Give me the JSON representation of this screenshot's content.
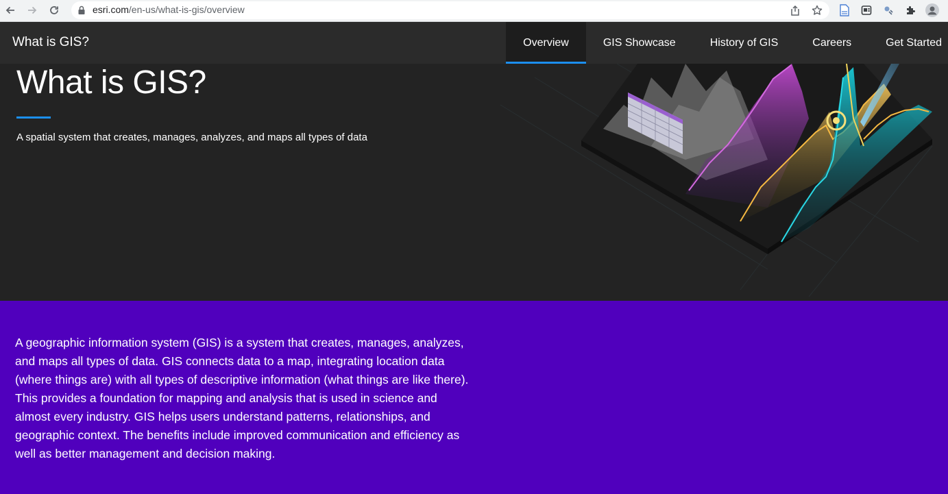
{
  "browser": {
    "url_domain": "esri.com",
    "url_path": "/en-us/what-is-gis/overview"
  },
  "site": {
    "title": "What is GIS?",
    "tabs": [
      {
        "label": "Overview",
        "active": true
      },
      {
        "label": "GIS Showcase",
        "active": false
      },
      {
        "label": "History of GIS",
        "active": false
      },
      {
        "label": "Careers",
        "active": false
      },
      {
        "label": "Get Started",
        "active": false
      }
    ]
  },
  "hero": {
    "title": "What is GIS?",
    "subtitle": "A spatial system that creates, manages, analyzes, and maps all types of data"
  },
  "intro": {
    "text": "A geographic information system (GIS) is a system that creates, manages, analyzes, and maps all types of data. GIS connects data to a map, integrating location data (where things are) with all types of descriptive information (what things are like there). This provides a foundation for mapping and analysis that is used in science and almost every industry. GIS helps users understand patterns, relationships, and geographic context. The benefits include improved communication and efficiency as well as better management and decision making."
  },
  "colors": {
    "accent": "#1c8ff0",
    "nav_bg": "#2b2b2b",
    "hero_bg": "#232323",
    "intro_bg": "#5000bd"
  },
  "icons": [
    "back-arrow-icon",
    "forward-arrow-icon",
    "reload-icon",
    "lock-icon",
    "share-icon",
    "bookmark-star-icon",
    "document-extension-icon",
    "extension-icon",
    "satellite-extension-icon",
    "puzzle-extensions-icon",
    "profile-avatar-icon"
  ]
}
